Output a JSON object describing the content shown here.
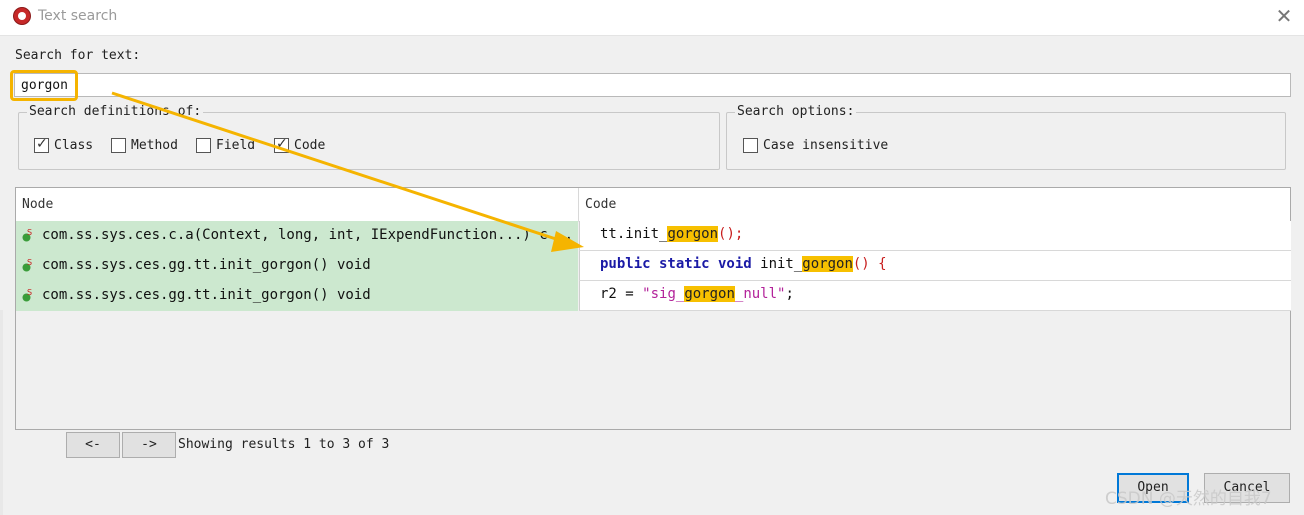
{
  "window": {
    "title": "Text search",
    "close_glyph": "✕",
    "icon": "app-logo-icon"
  },
  "search": {
    "label": "Search for text:",
    "value": "gorgon"
  },
  "definitions": {
    "title": "Search definitions of:",
    "options": [
      {
        "label": "Class",
        "checked": true
      },
      {
        "label": "Method",
        "checked": false
      },
      {
        "label": "Field",
        "checked": false
      },
      {
        "label": "Code",
        "checked": true
      }
    ]
  },
  "search_options": {
    "title": "Search options:",
    "options": [
      {
        "label": "Case insensitive",
        "checked": false
      }
    ]
  },
  "results": {
    "columns": {
      "node": "Node",
      "code": "Code"
    },
    "rows": [
      {
        "node": "com.ss.sys.ces.c.a(Context, long, int, IExpendFunction...) c...",
        "code": [
          {
            "t": "tt.init_",
            "c": "fn"
          },
          {
            "t": "gorgon",
            "c": "hl"
          },
          {
            "t": "();",
            "c": "red"
          }
        ]
      },
      {
        "node": "com.ss.sys.ces.gg.tt.init_gorgon() void",
        "code": [
          {
            "t": "public static void",
            "c": "kw"
          },
          {
            "t": " init_",
            "c": "fn"
          },
          {
            "t": "gorgon",
            "c": "hl"
          },
          {
            "t": "() {",
            "c": "red"
          }
        ]
      },
      {
        "node": "com.ss.sys.ces.gg.tt.init_gorgon() void",
        "code": [
          {
            "t": "r2 = ",
            "c": "fn"
          },
          {
            "t": "\"sig_",
            "c": "str"
          },
          {
            "t": "gorgon",
            "c": "hl"
          },
          {
            "t": "_null\"",
            "c": "str"
          },
          {
            "t": ";",
            "c": "fn"
          }
        ]
      }
    ],
    "node_icon": "method-lock-icon"
  },
  "pagination": {
    "prev": "<-",
    "next": "->",
    "status": "Showing results 1 to 3 of 3"
  },
  "buttons": {
    "open": "Open",
    "cancel": "Cancel"
  },
  "watermark": "CSDN @天然的自我7",
  "colors": {
    "highlight": "#f7c000",
    "node_bg": "#cce8cf",
    "annotation": "#f5b400",
    "accent": "#0078d7"
  }
}
